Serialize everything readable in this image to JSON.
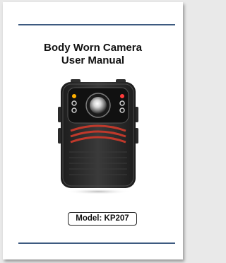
{
  "document": {
    "title_line1": "Body Worn Camera",
    "title_line2": "User Manual",
    "model_label": "Model: KP207"
  },
  "colors": {
    "rule": "#3d5a80",
    "camera_body": "#2b2b2b",
    "accent_wave": "#c0392b"
  },
  "icons": {
    "product_image": "body-camera-illustration"
  }
}
